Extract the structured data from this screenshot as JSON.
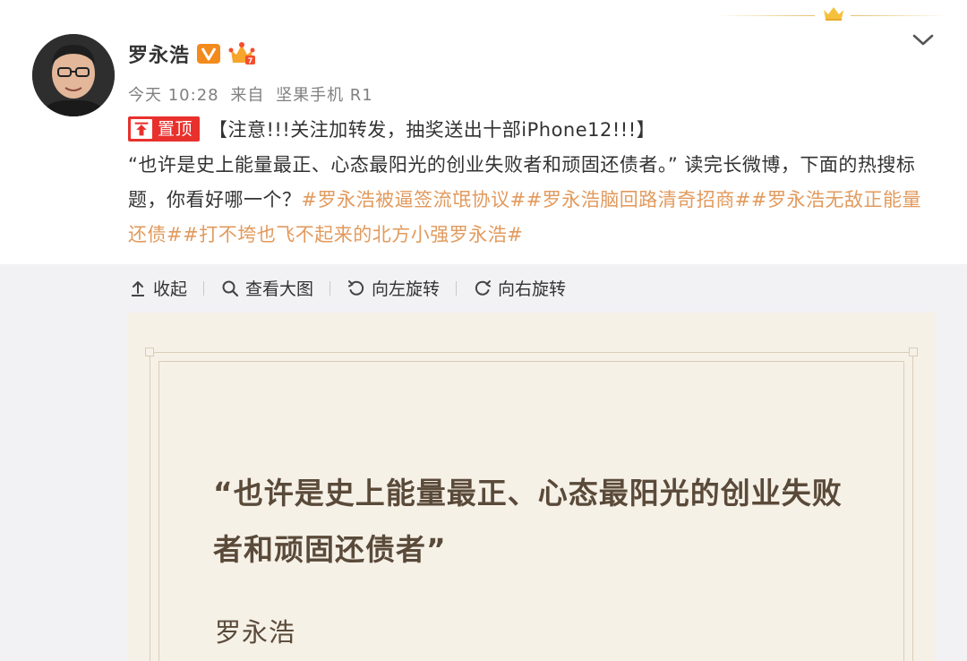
{
  "post": {
    "user_name": "罗永浩",
    "time": "今天 10:28",
    "source_prefix": "来自",
    "source_device": "坚果手机 R1",
    "pin_label": "置顶",
    "text_line1": "【注意!!!关注加转发，抽奖送出十部iPhone12!!!】",
    "text_line2": "“也许是史上能量最正、心态最阳光的创业失败者和顽固还债者。” 读完长微博，下面的热搜标题，你看好哪一个？",
    "topics": [
      "#罗永浩被逼签流氓协议#",
      "#罗永浩脑回路清奇招商#",
      "#罗永浩无敌正能量还债#",
      "#打不垮也飞不起来的北方小强罗永浩#"
    ]
  },
  "toolbar": {
    "collapse": "收起",
    "view_large": "查看大图",
    "rotate_left": "向左旋转",
    "rotate_right": "向右旋转"
  },
  "image": {
    "quote": "“也许是史上能量最正、心态最阳光的创业失败者和顽固还债者”",
    "author": "罗永浩"
  },
  "colors": {
    "topic": "#e29a5d",
    "pin": "#e8312d",
    "v_badge": "#f38a1c",
    "image_bg": "#f6f1e7",
    "quote_text": "#5a4a3a"
  },
  "icons": [
    "crown-icon",
    "chevron-down-icon",
    "verified-v-icon",
    "vip-crown-icon",
    "pin-icon",
    "collapse-icon",
    "magnifier-icon",
    "rotate-left-icon",
    "rotate-right-icon"
  ]
}
